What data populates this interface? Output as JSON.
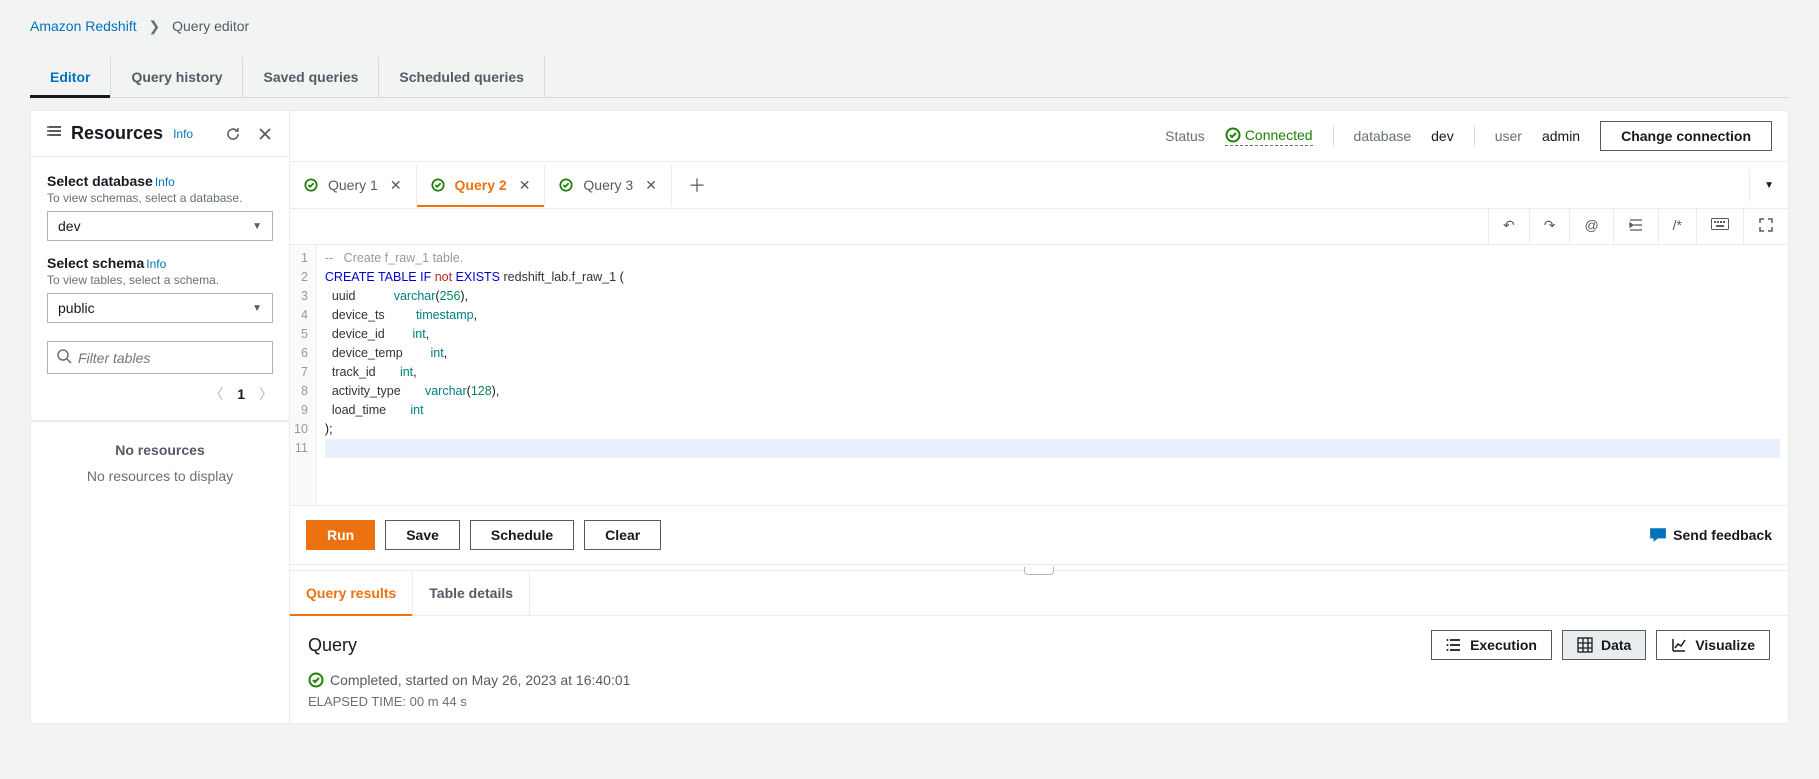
{
  "breadcrumb": {
    "service": "Amazon Redshift",
    "page": "Query editor"
  },
  "main_tabs": [
    "Editor",
    "Query history",
    "Saved queries",
    "Scheduled queries"
  ],
  "sidebar": {
    "title": "Resources",
    "info": "Info",
    "db_label": "Select database",
    "db_info": "Info",
    "db_hint": "To view schemas, select a database.",
    "db_value": "dev",
    "schema_label": "Select schema",
    "schema_info": "Info",
    "schema_hint": "To view tables, select a schema.",
    "schema_value": "public",
    "filter_placeholder": "Filter tables",
    "page": "1",
    "no_res_title": "No resources",
    "no_res_text": "No resources to display"
  },
  "status_bar": {
    "status_label": "Status",
    "status_value": "Connected",
    "db_label": "database",
    "db_value": "dev",
    "user_label": "user",
    "user_value": "admin",
    "change": "Change connection"
  },
  "query_tabs": [
    {
      "label": "Query 1",
      "active": false
    },
    {
      "label": "Query 2",
      "active": true
    },
    {
      "label": "Query 3",
      "active": false
    }
  ],
  "code_lines": [
    {
      "html": "<span class='c-comment'>--   Create f_raw_1 table.</span>"
    },
    {
      "html": "<span class='c-kw'>CREATE</span> <span class='c-kw'>TABLE</span> <span class='c-kw'>IF</span> <span class='c-neg'>not</span> <span class='c-kw'>EXISTS</span> <span class='c-id'>redshift_lab.f_raw_1</span> ("
    },
    {
      "html": "  <span class='c-id'>uuid</span>           <span class='c-kw2'>varchar</span>(<span class='c-num'>256</span>),"
    },
    {
      "html": "  <span class='c-id'>device_ts</span>         <span class='c-kw2'>timestamp</span>,"
    },
    {
      "html": "  <span class='c-id'>device_id</span>        <span class='c-kw2'>int</span>,"
    },
    {
      "html": "  <span class='c-id'>device_temp</span>        <span class='c-kw2'>int</span>,"
    },
    {
      "html": "  <span class='c-id'>track_id</span>       <span class='c-kw2'>int</span>,"
    },
    {
      "html": "  <span class='c-id'>activity_type</span>       <span class='c-kw2'>varchar</span>(<span class='c-num'>128</span>),"
    },
    {
      "html": "  <span class='c-id'>load_time</span>       <span class='c-kw2'>int</span>"
    },
    {
      "html": ");"
    },
    {
      "html": "",
      "hl": true
    }
  ],
  "actions": {
    "run": "Run",
    "save": "Save",
    "schedule": "Schedule",
    "clear": "Clear",
    "feedback": "Send feedback"
  },
  "result_tabs": [
    "Query results",
    "Table details"
  ],
  "result": {
    "title": "Query",
    "views": {
      "exec": "Execution",
      "data": "Data",
      "viz": "Visualize"
    },
    "status": "Completed, started on May 26, 2023 at 16:40:01",
    "elapsed": "ELAPSED TIME: 00 m 44 s"
  }
}
